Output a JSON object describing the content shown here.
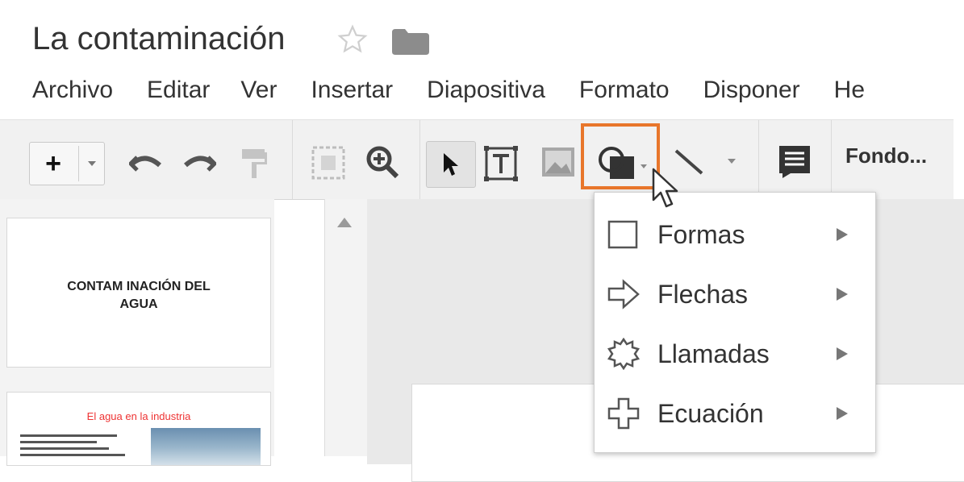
{
  "document": {
    "title": "La contaminación"
  },
  "menu": [
    "Archivo",
    "Editar",
    "Ver",
    "Insertar",
    "Diapositiva",
    "Formato",
    "Disponer",
    "He"
  ],
  "toolbar": {
    "background_label": "Fondo..."
  },
  "shape_menu": {
    "items": [
      {
        "label": "Formas",
        "icon": "square-icon"
      },
      {
        "label": "Flechas",
        "icon": "arrow-right-icon"
      },
      {
        "label": "Llamadas",
        "icon": "callout-icon"
      },
      {
        "label": "Ecuación",
        "icon": "plus-shape-icon"
      }
    ]
  },
  "slides": [
    {
      "title_line1": "CONTAM INACIÓN DEL",
      "title_line2": "AGUA"
    },
    {
      "title": "El agua en la industria"
    }
  ],
  "colors": {
    "highlight": "#e8762b",
    "toolbar": "#f1f1f1"
  }
}
